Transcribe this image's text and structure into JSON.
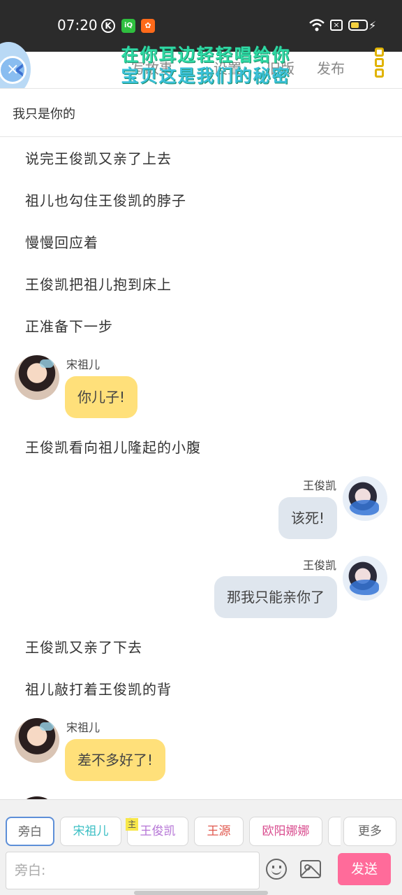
{
  "status_bar": {
    "time": "07:20",
    "app_icons": [
      "k-icon",
      "iqiyi-icon",
      "kuaishou-icon"
    ],
    "battery_color": "#f4d03f"
  },
  "nav": {
    "tabs": [
      "写故事",
      "设置",
      "旧版",
      "发布"
    ],
    "overlay_line1": "在你耳边轻轻唱给你",
    "overlay_line2": "宝贝这是我们的秘密"
  },
  "story_title": "我只是你的",
  "messages": [
    {
      "type": "narration",
      "text": "说完王俊凯又亲了上去"
    },
    {
      "type": "narration",
      "text": "祖儿也勾住王俊凯的脖子"
    },
    {
      "type": "narration",
      "text": "慢慢回应着"
    },
    {
      "type": "narration",
      "text": "王俊凯把祖儿抱到床上"
    },
    {
      "type": "narration",
      "text": "正准备下一步"
    },
    {
      "type": "chat",
      "side": "left",
      "speaker": "宋祖儿",
      "text": "你儿子!"
    },
    {
      "type": "narration",
      "text": "王俊凯看向祖儿隆起的小腹"
    },
    {
      "type": "chat",
      "side": "right",
      "speaker": "王俊凯",
      "text": "该死!"
    },
    {
      "type": "chat",
      "side": "right",
      "speaker": "王俊凯",
      "text": "那我只能亲你了"
    },
    {
      "type": "narration",
      "text": "王俊凯又亲了下去"
    },
    {
      "type": "narration",
      "text": "祖儿敲打着王俊凯的背"
    },
    {
      "type": "chat",
      "side": "left",
      "speaker": "宋祖儿",
      "text": "差不多好了!"
    }
  ],
  "characters": {
    "chips": [
      "旁白",
      "宋祖儿",
      "王俊凯",
      "王源",
      "欧阳娜娜"
    ],
    "lead_tag": "主",
    "more_label": "更多"
  },
  "composer": {
    "placeholder": "旁白:",
    "send_label": "发送"
  },
  "colors": {
    "accent_pink": "#ff6b9a",
    "bubble_yellow": "#ffe07a",
    "bubble_grey": "#dfe6ee",
    "chip_active": "#5d8fd8"
  }
}
